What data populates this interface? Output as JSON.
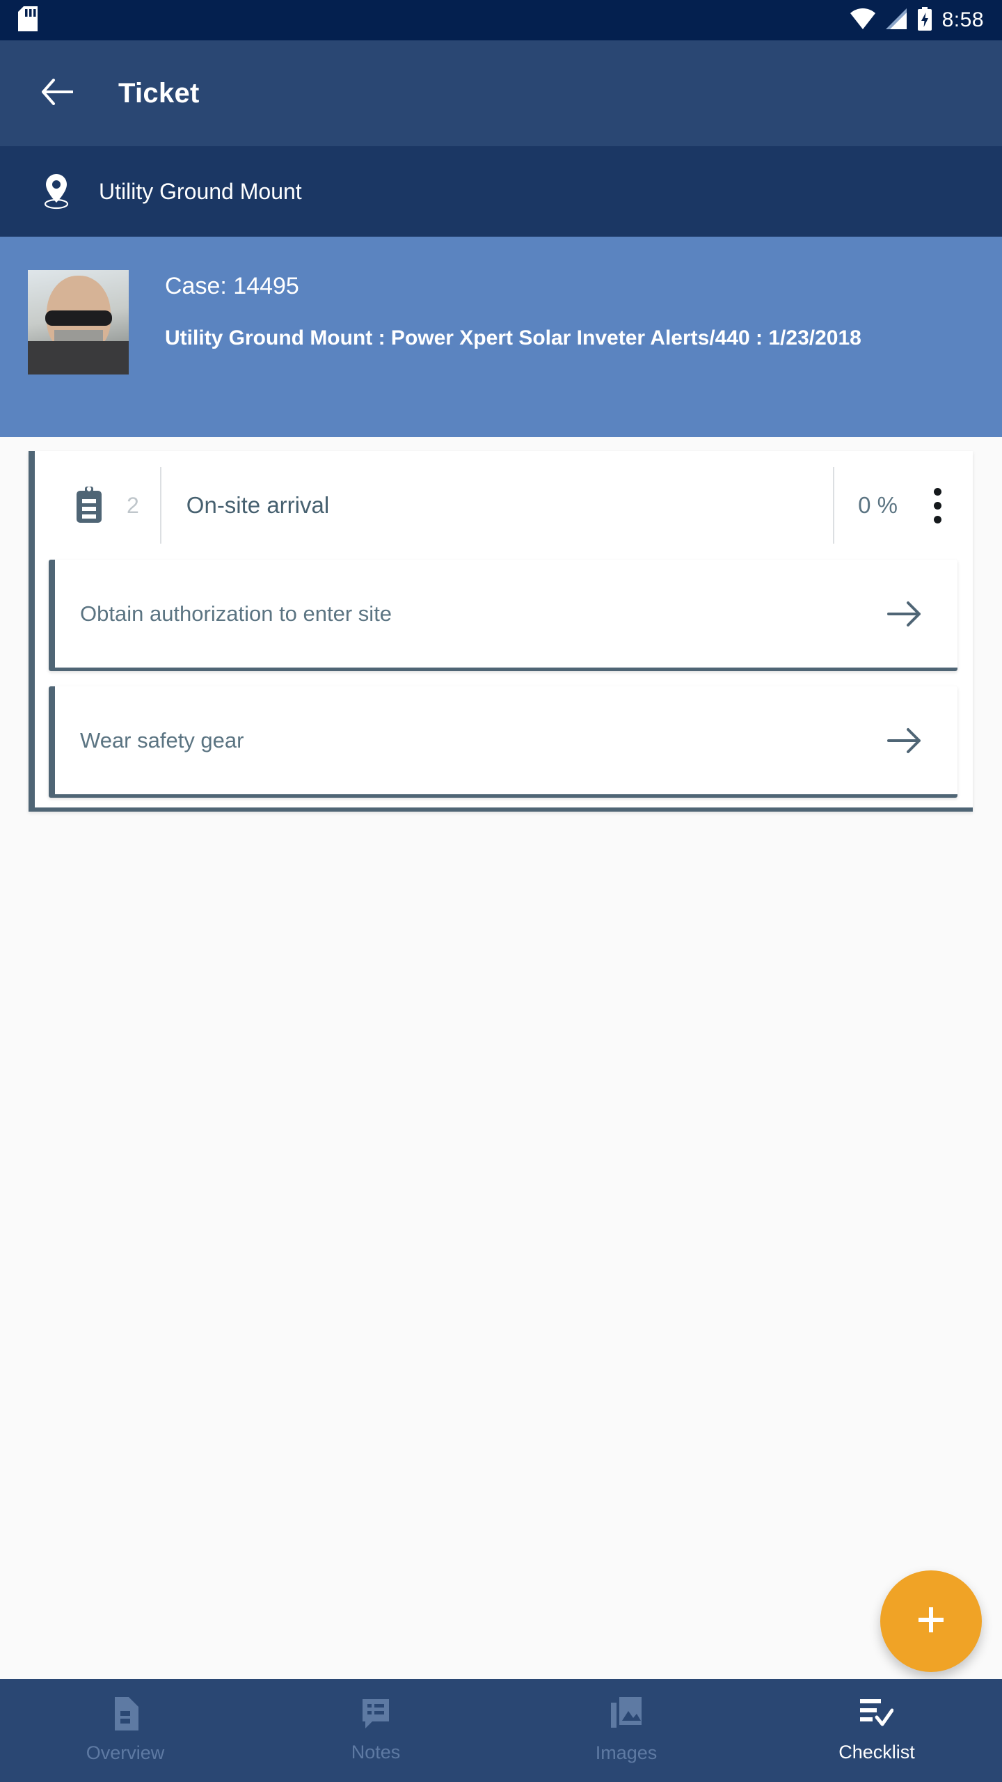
{
  "status_bar": {
    "time": "8:58",
    "icons": [
      "sd-card-icon",
      "wifi-icon",
      "cell-signal-icon",
      "battery-charging-icon"
    ],
    "background": "#04204F"
  },
  "app_bar": {
    "title": "Ticket",
    "back_icon": "arrow-left-icon",
    "background": "#2A4773"
  },
  "location_bar": {
    "icon": "map-pin-icon",
    "label": "Utility Ground Mount",
    "background": "#1B3764"
  },
  "case_card": {
    "avatar_alt": "technician-photo",
    "case_label": "Case: 14495",
    "description": "Utility Ground Mount : Power Xpert Solar Inveter Alerts/440 : 1/23/2018",
    "background": "#5B84C0"
  },
  "checklist": {
    "group": {
      "icon": "clipboard-icon",
      "count": "2",
      "title": "On-site arrival",
      "progress": "0 %",
      "menu_icon": "more-vertical-icon"
    },
    "tasks": [
      {
        "label": "Obtain authorization to enter site",
        "arrow_icon": "arrow-right-icon"
      },
      {
        "label": "Wear safety gear",
        "arrow_icon": "arrow-right-icon"
      }
    ],
    "accent": "#4F6575"
  },
  "fab": {
    "icon": "plus-icon",
    "color": "#F0A326"
  },
  "bottom_nav": {
    "items": [
      {
        "label": "Overview",
        "icon": "document-icon",
        "active": false
      },
      {
        "label": "Notes",
        "icon": "notes-icon",
        "active": false
      },
      {
        "label": "Images",
        "icon": "images-icon",
        "active": false
      },
      {
        "label": "Checklist",
        "icon": "checklist-icon",
        "active": true
      }
    ],
    "background": "#2A4773"
  }
}
